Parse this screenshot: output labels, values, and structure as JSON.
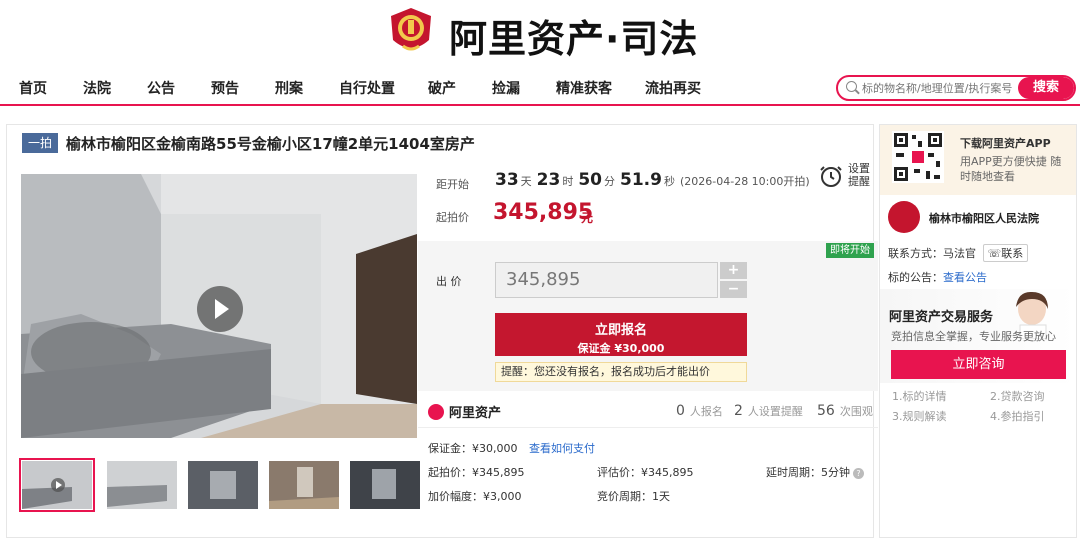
{
  "header": {
    "logo_text": "阿里资产·司法"
  },
  "nav": {
    "items": [
      "首页",
      "法院",
      "公告",
      "预告",
      "刑案",
      "自行处置",
      "破产",
      "捡漏",
      "精准获客",
      "流拍再买"
    ]
  },
  "search": {
    "placeholder": "标的物名称/地理位置/执行案号",
    "button_label": "搜索"
  },
  "listing": {
    "round_badge": "一拍",
    "title": "榆林市榆阳区金榆南路55号金榆小区17幢2单元1404室房产"
  },
  "countdown": {
    "label": "距开始",
    "days": "33",
    "days_unit": "天",
    "hours": "23",
    "hours_unit": "时",
    "minutes": "50",
    "minutes_unit": "分",
    "seconds": "51.9",
    "seconds_unit": "秒",
    "start_time": "(2026-04-28 10:00开拍)"
  },
  "reminder": {
    "label": "设置提醒"
  },
  "price": {
    "label": "起拍价",
    "value": "345,895",
    "unit": "元"
  },
  "bid": {
    "status_badge": "即将开始",
    "label": "出 价",
    "value": "345,895",
    "plus": "+",
    "minus": "−",
    "signup_label": "立即报名",
    "deposit_line": "保证金 ¥30,000",
    "tip": "提醒：您还没有报名，报名成功后才能出价"
  },
  "brand": {
    "name": "阿里资产"
  },
  "stats": [
    {
      "count": "0",
      "label": "人报名"
    },
    {
      "count": "2",
      "label": "人设置提醒"
    },
    {
      "count": "56",
      "label": "次围观"
    }
  ],
  "details": {
    "deposit_key": "保证金：",
    "deposit_val": "¥30,000",
    "deposit_link": "查看如何支付",
    "start_price_key": "起拍价：",
    "start_price_val": "¥345,895",
    "appraisal_key": "评估价：",
    "appraisal_val": "¥345,895",
    "delay_key": "延时周期：",
    "delay_val": "5分钟",
    "increment_key": "加价幅度：",
    "increment_val": "¥3,000",
    "period_key": "竞价周期：",
    "period_val": "1天"
  },
  "sidebar": {
    "app_title": "下载阿里资产APP",
    "app_desc": "用APP更方便快捷 随时随地查看",
    "court_name": "榆林市榆阳区人民法院",
    "contact_key": "联系方式：",
    "contact_name": "马法官",
    "contact_button": "联系",
    "notice_key": "标的公告：",
    "notice_link": "查看公告",
    "service_title": "阿里资产交易服务",
    "service_sub": "竞拍信息全掌握，专业服务更放心",
    "consult_button": "立即咨询",
    "links": [
      "1.标的详情",
      "2.贷款咨询",
      "3.规则解读",
      "4.参拍指引"
    ]
  },
  "colors": {
    "accent": "#e8144f",
    "price_red": "#c4152e",
    "badge_blue": "#4a6a9a",
    "green": "#2fa24e",
    "link_blue": "#2a6acb"
  }
}
